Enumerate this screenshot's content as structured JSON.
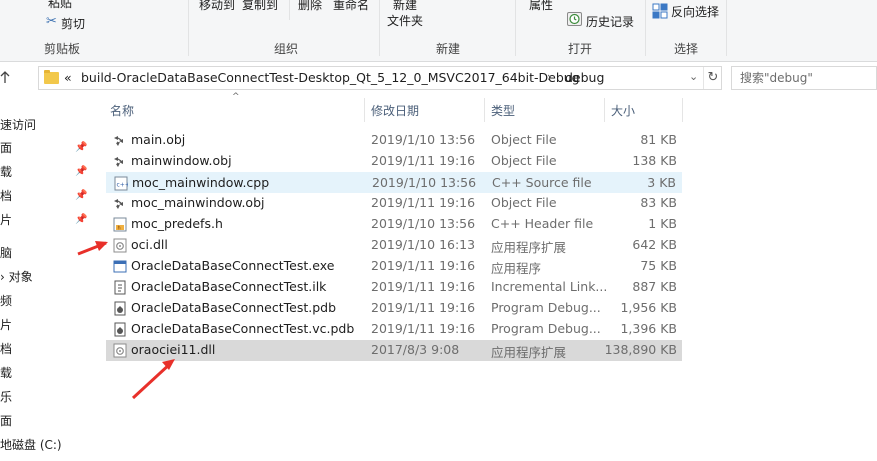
{
  "ribbon": {
    "top_partial_paste": "粘贴",
    "cut": "剪切",
    "group_clipboard": "剪贴板",
    "move_to": "移动到",
    "copy_to": "复制到",
    "delete": "删除",
    "rename": "重命名",
    "group_organize": "组织",
    "new_folder_top": "新建",
    "new_folder_bottom": "文件夹",
    "group_new": "新建",
    "properties": "属性",
    "history": "历史记录",
    "group_open": "打开",
    "invert_selection": "反向选择",
    "group_select": "选择"
  },
  "address": {
    "overflow": "«",
    "path_1": "build-OracleDataBaseConnectTest-Desktop_Qt_5_12_0_MSVC2017_64bit-Debug",
    "separator": "›",
    "path_2": "debug",
    "dropdown": "⌄",
    "refresh": "↻"
  },
  "search": {
    "placeholder": "搜索\"debug\""
  },
  "nav": {
    "items": [
      "速访问",
      "面",
      "载",
      "档",
      "片",
      "脑",
      "› 对象",
      "频",
      "片",
      "档",
      "载",
      "乐",
      "面",
      "地磁盘 (C:)"
    ]
  },
  "columns": {
    "name": "名称",
    "date": "修改日期",
    "type": "类型",
    "size": "大小",
    "sort": "^"
  },
  "files": [
    {
      "name": "main.obj",
      "date": "2019/1/10 13:56",
      "type": "Object File",
      "size": "81 KB",
      "icon": "obj-icon"
    },
    {
      "name": "mainwindow.obj",
      "date": "2019/1/11 19:16",
      "type": "Object File",
      "size": "138 KB",
      "icon": "obj-icon"
    },
    {
      "name": "moc_mainwindow.cpp",
      "date": "2019/1/10 13:56",
      "type": "C++ Source file",
      "size": "3 KB",
      "icon": "cpp-icon"
    },
    {
      "name": "moc_mainwindow.obj",
      "date": "2019/1/11 19:16",
      "type": "Object File",
      "size": "83 KB",
      "icon": "obj-icon"
    },
    {
      "name": "moc_predefs.h",
      "date": "2019/1/10 13:56",
      "type": "C++ Header file",
      "size": "1 KB",
      "icon": "header-icon"
    },
    {
      "name": "oci.dll",
      "date": "2019/1/10 16:13",
      "type": "应用程序扩展",
      "size": "642 KB",
      "icon": "dll-icon"
    },
    {
      "name": "OracleDataBaseConnectTest.exe",
      "date": "2019/1/11 19:16",
      "type": "应用程序",
      "size": "75 KB",
      "icon": "exe-icon"
    },
    {
      "name": "OracleDataBaseConnectTest.ilk",
      "date": "2019/1/11 19:16",
      "type": "Incremental Link...",
      "size": "887 KB",
      "icon": "ilk-icon"
    },
    {
      "name": "OracleDataBaseConnectTest.pdb",
      "date": "2019/1/11 19:16",
      "type": "Program Debug...",
      "size": "1,956 KB",
      "icon": "pdb-icon"
    },
    {
      "name": "OracleDataBaseConnectTest.vc.pdb",
      "date": "2019/1/11 19:16",
      "type": "Program Debug...",
      "size": "1,396 KB",
      "icon": "pdb-icon"
    },
    {
      "name": "oraociei11.dll",
      "date": "2017/8/3 9:08",
      "type": "应用程序扩展",
      "size": "138,890 KB",
      "icon": "dll-icon"
    }
  ],
  "colors": {
    "accent_arrow": "#e8302a",
    "hover_row": "#e5f3fb",
    "selected_row": "#d9d9d9",
    "folder": "#f2c84b"
  }
}
